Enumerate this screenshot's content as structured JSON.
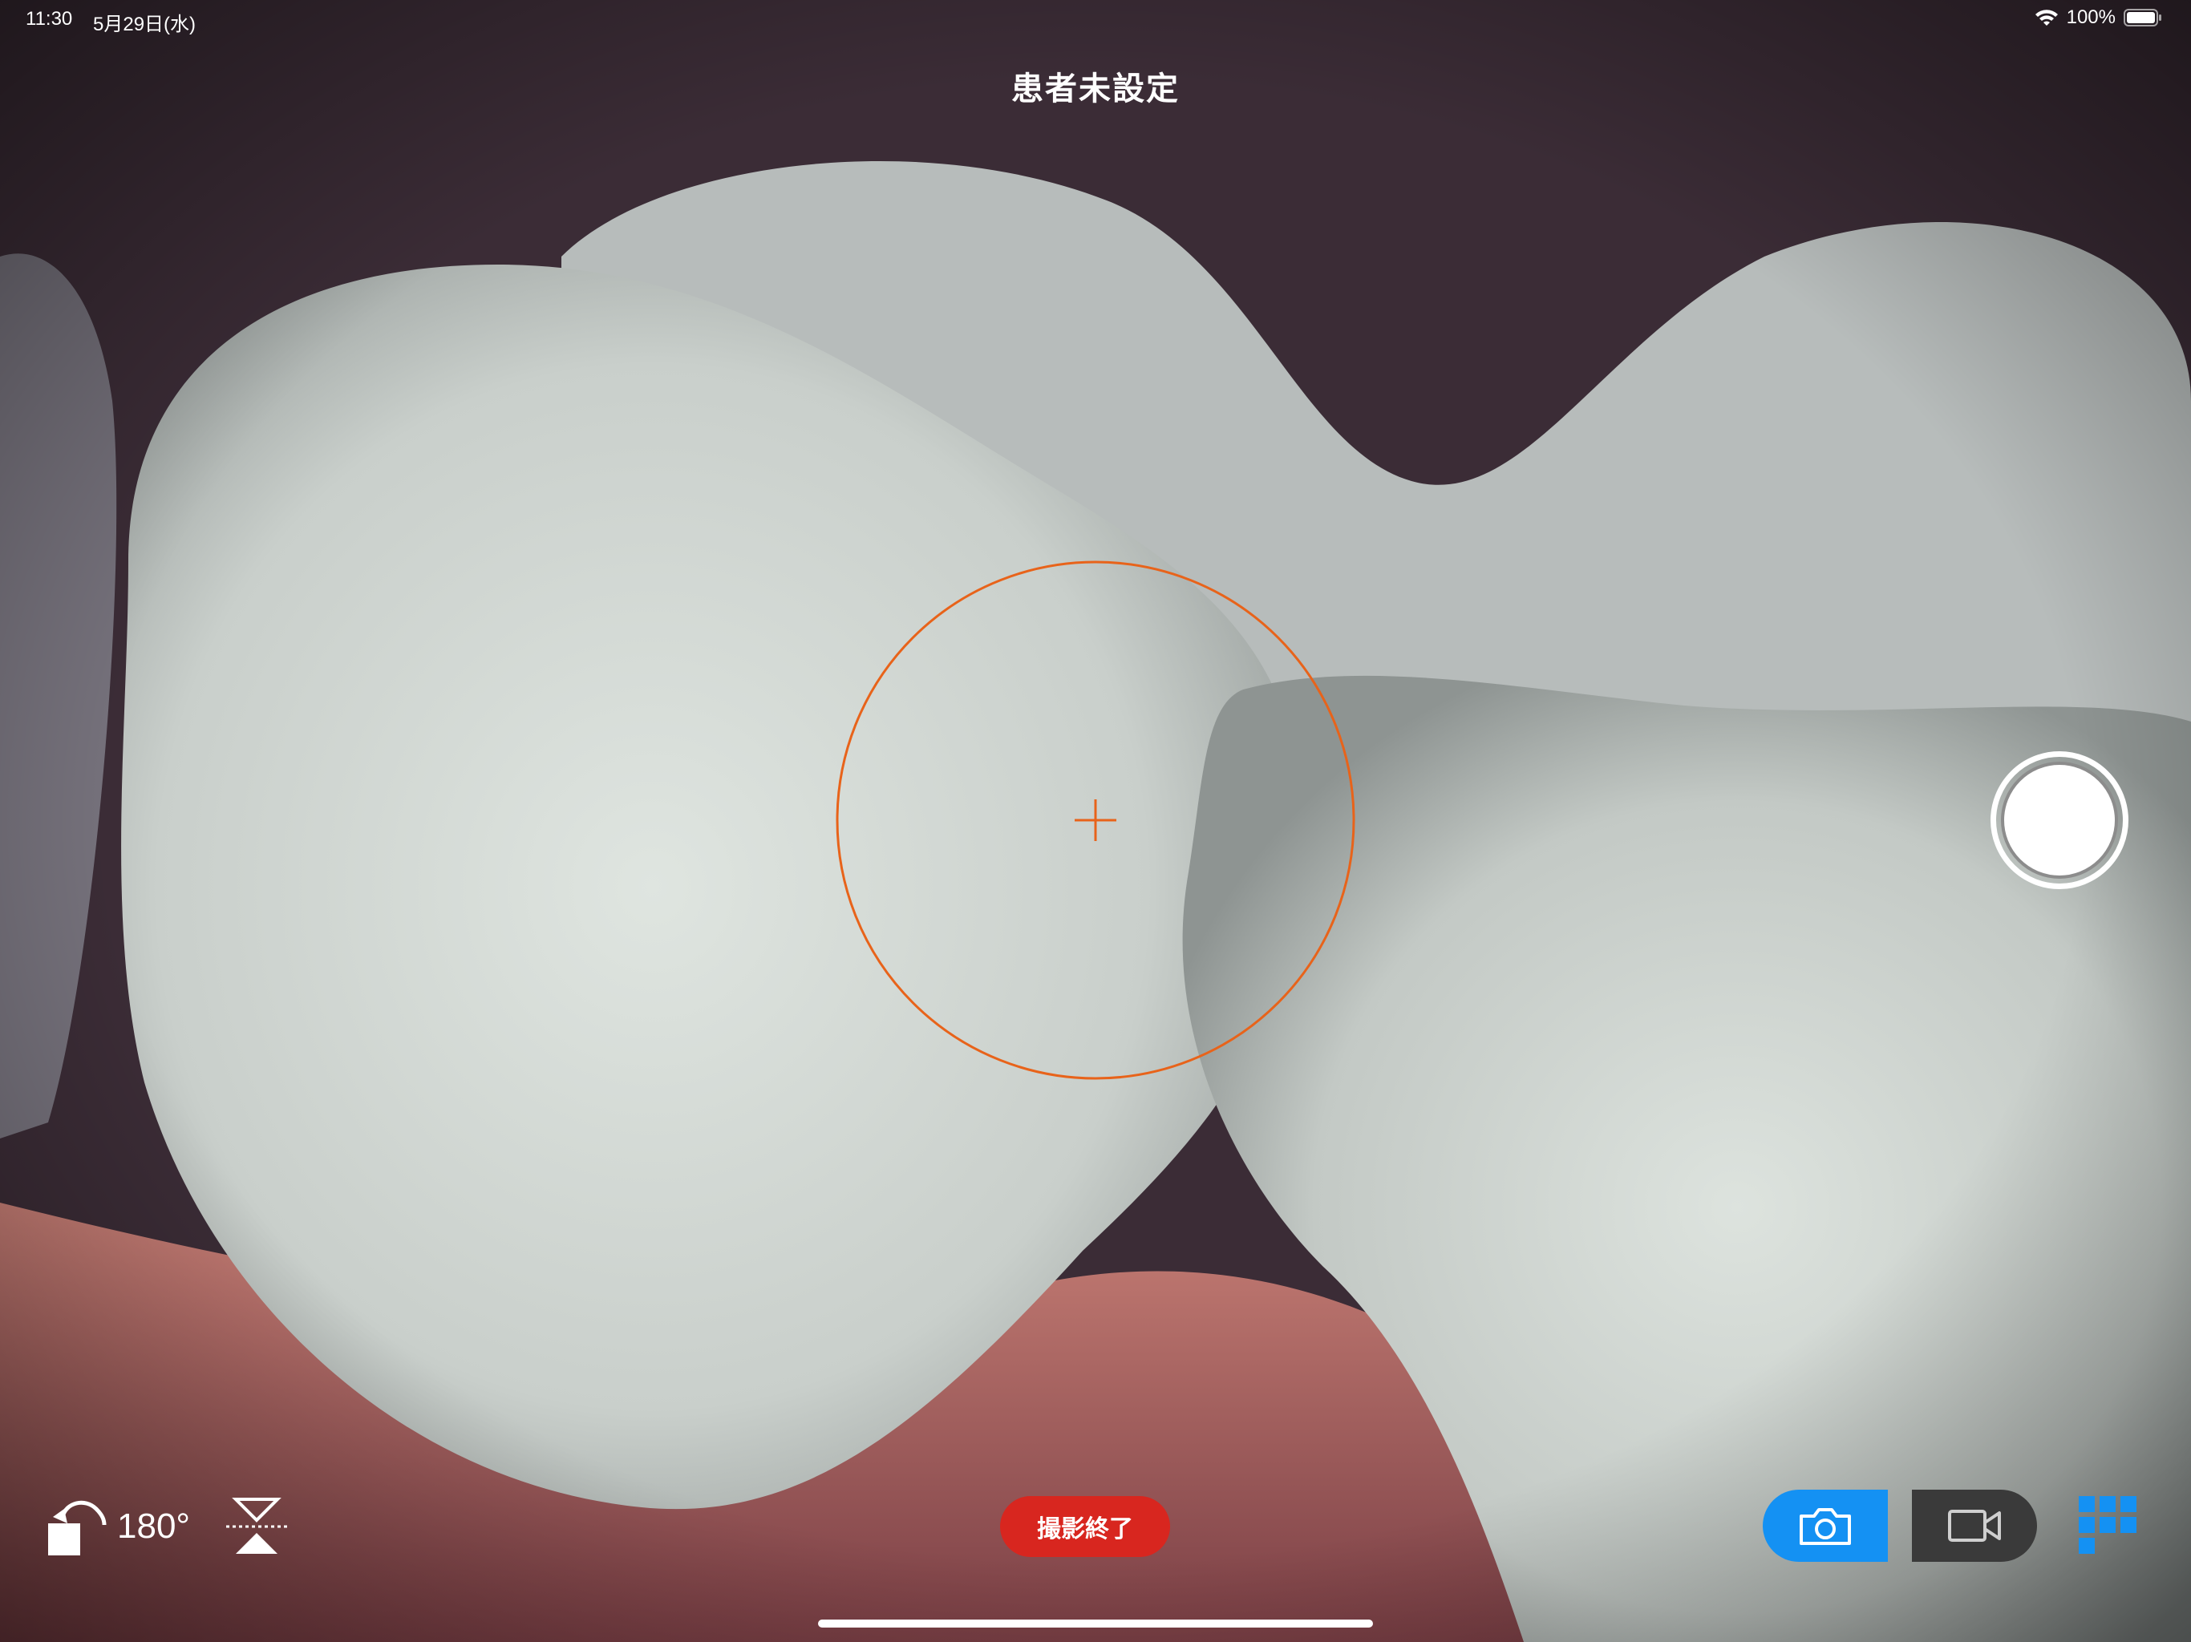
{
  "status_bar": {
    "time": "11:30",
    "date": "5月29日(水)",
    "battery_percent": "100%",
    "icons": [
      "wifi-icon",
      "battery-icon"
    ]
  },
  "header": {
    "patient_title": "患者未設定"
  },
  "controls": {
    "rotate_label": "180°",
    "end_capture_label": "撮影終了",
    "modes": [
      "photo",
      "video"
    ],
    "selected_mode": "photo"
  },
  "icons": {
    "rotate": "rotate-icon",
    "flip": "flip-vertical-icon",
    "photo": "camera-icon",
    "video": "video-icon",
    "gallery": "grid-gallery-icon",
    "shutter": "shutter-button",
    "reticle": "focus-reticle"
  },
  "colors": {
    "accent_blue": "#1491f3",
    "end_red": "#d8261f",
    "reticle_orange": "#e8631a",
    "video_dark": "#3a3a3a"
  }
}
